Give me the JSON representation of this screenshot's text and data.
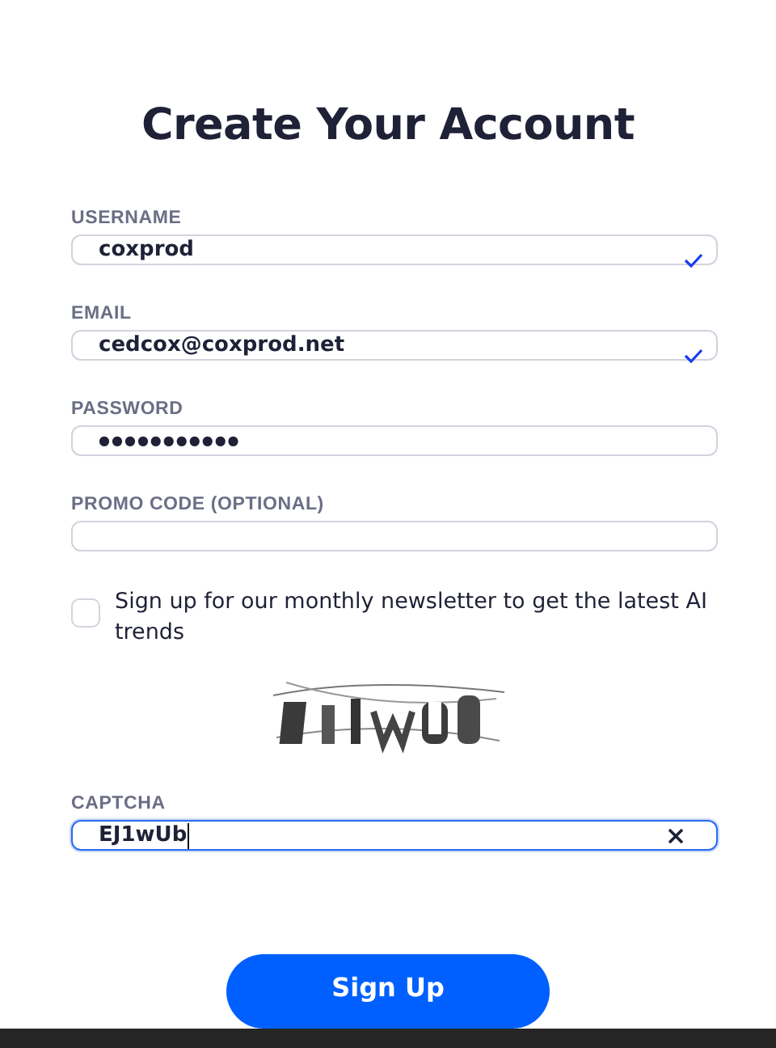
{
  "title": "Create Your Account",
  "fields": [
    {
      "kind": "text",
      "label": "USERNAME",
      "value": "coxprod",
      "valid": true,
      "focused": false
    },
    {
      "kind": "text",
      "label": "EMAIL",
      "value": "cedcox@coxprod.net",
      "valid": true,
      "focused": false
    },
    {
      "kind": "password",
      "label": "PASSWORD",
      "value": "●●●●●●●●●●●",
      "valid": false,
      "focused": false
    },
    {
      "kind": "text",
      "label": "PROMO CODE (OPTIONAL)",
      "valid": false,
      "focused": false
    }
  ],
  "newsletter": {
    "label": "Sign up for our monthly newsletter to get the latest AI trends",
    "checked": false
  },
  "captcha_field": {
    "kind": "clearable",
    "label": "CAPTCHA",
    "value": "EJ1wUb",
    "valid": false,
    "focused": true
  },
  "submit": "Sign Up"
}
